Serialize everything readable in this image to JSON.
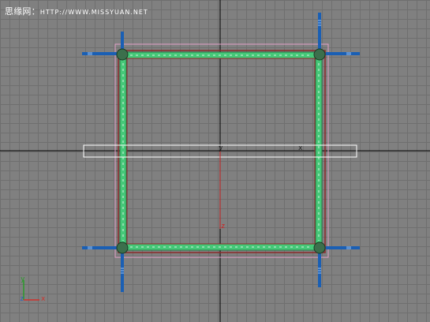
{
  "watermark": {
    "prefix": "思缘网：",
    "url": "HTTP://WWW.MISSYUAN.NET"
  },
  "gizmo": {
    "x_label": "x",
    "y_label": "y",
    "z_label": "z"
  },
  "transform_axes": {
    "x_label": "x",
    "y_label": "y",
    "z_label": "z"
  },
  "colors": {
    "grid_bg": "#808080",
    "grid_line": "#6f6f6f",
    "world_axis": "#000000",
    "frame_green": "#45c878",
    "frame_inner": "#3aa060",
    "frame_outline_red": "#8b2a2a",
    "selection_box": "#ffffff",
    "bound_box": "#e3a0c8",
    "post_blue": "#1a5fb4",
    "x_axis": "#d0302a",
    "y_axis": "#2a9a2a",
    "z_axis": "#c02020"
  }
}
